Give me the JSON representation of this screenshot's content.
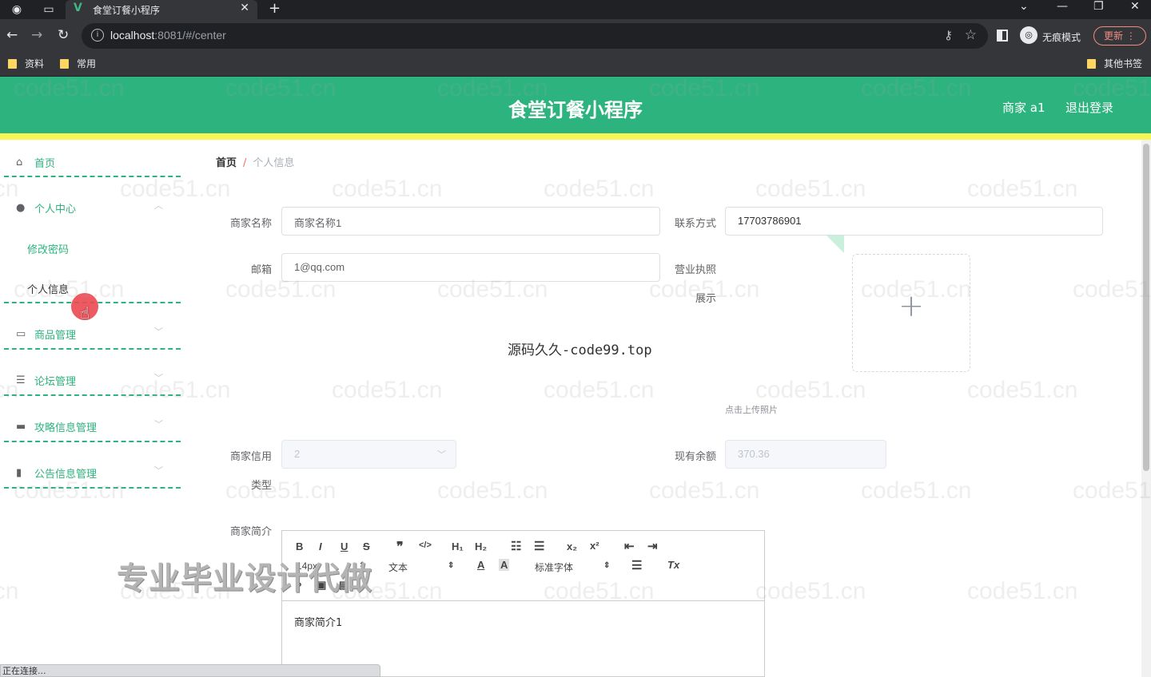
{
  "browser": {
    "tab_title": "食堂订餐小程序",
    "url_host": "localhost",
    "url_rest": ":8081/#/center",
    "incognito_label": "无痕模式",
    "update_label": "更新",
    "bookmarks": [
      "资料",
      "常用"
    ],
    "other_bookmarks": "其他书签"
  },
  "header": {
    "title": "食堂订餐小程序",
    "user": "商家 a1",
    "logout": "退出登录"
  },
  "sidebar": {
    "home": "首页",
    "personal_center": "个人中心",
    "change_password": "修改密码",
    "personal_info": "个人信息",
    "product_mgmt": "商品管理",
    "forum_mgmt": "论坛管理",
    "strategy_mgmt": "攻略信息管理",
    "notice_mgmt": "公告信息管理"
  },
  "breadcrumb": {
    "home": "首页",
    "separator": "/",
    "current": "个人信息"
  },
  "form": {
    "merchant_name_label": "商家名称",
    "merchant_name_value": "商家名称1",
    "contact_label": "联系方式",
    "contact_value": "17703786901",
    "email_label": "邮箱",
    "email_value": "1@qq.com",
    "license_label_1": "营业执照",
    "license_label_2": "展示",
    "upload_tip": "点击上传照片",
    "credit_label_1": "商家信用",
    "credit_label_2": "类型",
    "credit_value": "2",
    "balance_label": "现有余额",
    "balance_value": "370.36",
    "intro_label": "商家简介",
    "intro_value": "商家简介1"
  },
  "editor": {
    "header_select": "文本",
    "size_select": "14px",
    "font_select": "标准字体"
  },
  "overlays": {
    "center_watermark": "源码久久-code99.top",
    "promo_text": "专业毕业设计代做",
    "repeat_watermark": "code51.cn",
    "status_text": "正在连接..."
  },
  "colors": {
    "brand_green": "#2db47e",
    "accent_yellow": "#f5f553",
    "breadcrumb_sep": "#f56c6c"
  },
  "icons": [
    "home-icon",
    "user-icon",
    "chat-icon",
    "list-icon",
    "monitor-icon",
    "book-icon",
    "plus-icon"
  ]
}
